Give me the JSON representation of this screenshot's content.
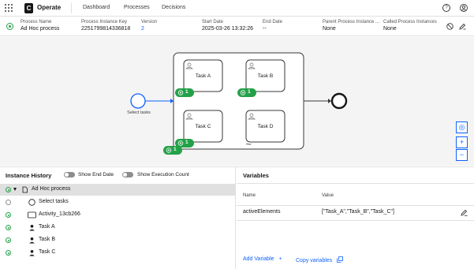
{
  "app": {
    "logo_letter": "C",
    "brand": "Operate",
    "nav": [
      "Dashboard",
      "Processes",
      "Decisions"
    ],
    "help_icon": "help-icon",
    "user_icon": "user-icon"
  },
  "instance": {
    "status": "active",
    "fields": [
      {
        "label": "Process Name",
        "value": "Ad Hoc process",
        "link": false
      },
      {
        "label": "Process Instance Key",
        "value": "2251799814336818",
        "link": false
      },
      {
        "label": "Version",
        "value": "2",
        "link": true
      },
      {
        "label": "Start Date",
        "value": "2025-03-26 13:32:26",
        "link": false
      },
      {
        "label": "End Date",
        "value": "--",
        "link": false
      },
      {
        "label": "Parent Process Instance ...",
        "value": "None",
        "link": false
      },
      {
        "label": "Called Process Instances",
        "value": "None",
        "link": false
      }
    ],
    "accent": "#24a148"
  },
  "diagram": {
    "start_event_label": "Select tasks",
    "tasks": [
      "Task A",
      "Task B",
      "Task C",
      "Task D"
    ],
    "badges": [
      "1",
      "1",
      "1",
      "1"
    ],
    "subprocess_badge": "1",
    "zoom": [
      "◎",
      "+",
      "−"
    ]
  },
  "history": {
    "title": "Instance History",
    "toggle_end_date": "Show End Date",
    "toggle_exec_count": "Show Execution Count",
    "rows": [
      {
        "label": "Ad Hoc process",
        "status": "active",
        "icon": "process-icon",
        "selected": true
      },
      {
        "label": "Select tasks",
        "status": "done",
        "icon": "start-event-icon",
        "selected": false
      },
      {
        "label": "Activity_13cb266",
        "status": "active",
        "icon": "subprocess-icon",
        "selected": false
      },
      {
        "label": "Task A",
        "status": "active",
        "icon": "user-task-icon",
        "selected": false
      },
      {
        "label": "Task B",
        "status": "active",
        "icon": "user-task-icon",
        "selected": false
      },
      {
        "label": "Task C",
        "status": "active",
        "icon": "user-task-icon",
        "selected": false
      }
    ]
  },
  "variables": {
    "title": "Variables",
    "col_name": "Name",
    "col_value": "Value",
    "rows": [
      {
        "name": "activeElements",
        "value": "[\"Task_A\",\"Task_B\",\"Task_C\"]"
      }
    ],
    "add_variable": "Add Variable",
    "copy_variables": "Copy variables"
  }
}
